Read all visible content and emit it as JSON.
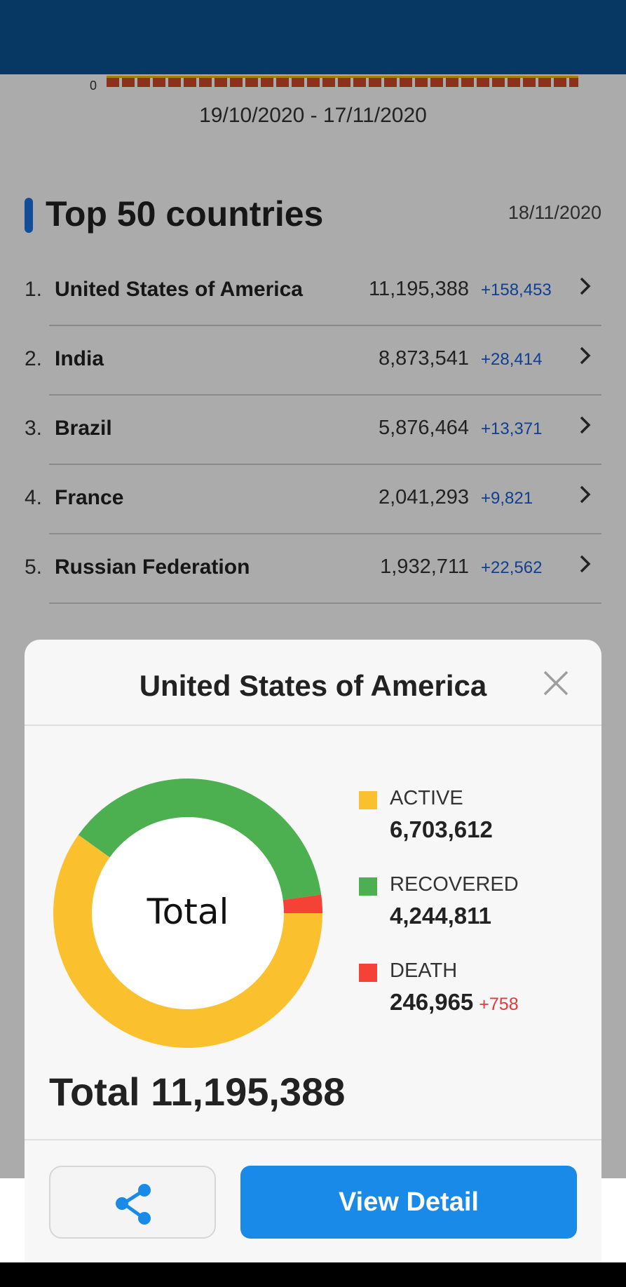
{
  "colors": {
    "header": "#0b5394",
    "accent": "#1a73e8",
    "active": "#fbc02d",
    "recovered": "#4caf50",
    "death": "#f44336",
    "delta_blue": "#1a5fd8",
    "delta_red": "#e53935"
  },
  "background": {
    "mini_chart": {
      "zero_label": "0"
    },
    "date_range": "19/10/2020 - 17/11/2020",
    "section": {
      "title": "Top 50 countries",
      "date": "18/11/2020"
    },
    "countries": [
      {
        "rank": "1.",
        "name": "United States of America",
        "total": "11,195,388",
        "delta": "+158,453"
      },
      {
        "rank": "2.",
        "name": "India",
        "total": "8,873,541",
        "delta": "+28,414"
      },
      {
        "rank": "3.",
        "name": "Brazil",
        "total": "5,876,464",
        "delta": "+13,371"
      },
      {
        "rank": "4.",
        "name": "France",
        "total": "2,041,293",
        "delta": "+9,821"
      },
      {
        "rank": "5.",
        "name": "Russian Federation",
        "total": "1,932,711",
        "delta": "+22,562"
      }
    ]
  },
  "modal": {
    "title": "United States of America",
    "close_icon": "close-icon",
    "donut_center": "Total",
    "legend": [
      {
        "label": "ACTIVE",
        "value": "6,703,612",
        "delta": ""
      },
      {
        "label": "RECOVERED",
        "value": "4,244,811",
        "delta": ""
      },
      {
        "label": "DEATH",
        "value": "246,965",
        "delta": "+758"
      }
    ],
    "total_text": "Total 11,195,388",
    "share_icon": "share-icon",
    "view_detail_label": "View Detail"
  },
  "chart_data": {
    "type": "pie",
    "categories": [
      "ACTIVE",
      "RECOVERED",
      "DEATH"
    ],
    "values": [
      6703612,
      4244811,
      246965
    ],
    "colors": [
      "#fbc02d",
      "#4caf50",
      "#f44336"
    ],
    "title": "",
    "center_label": "Total"
  }
}
